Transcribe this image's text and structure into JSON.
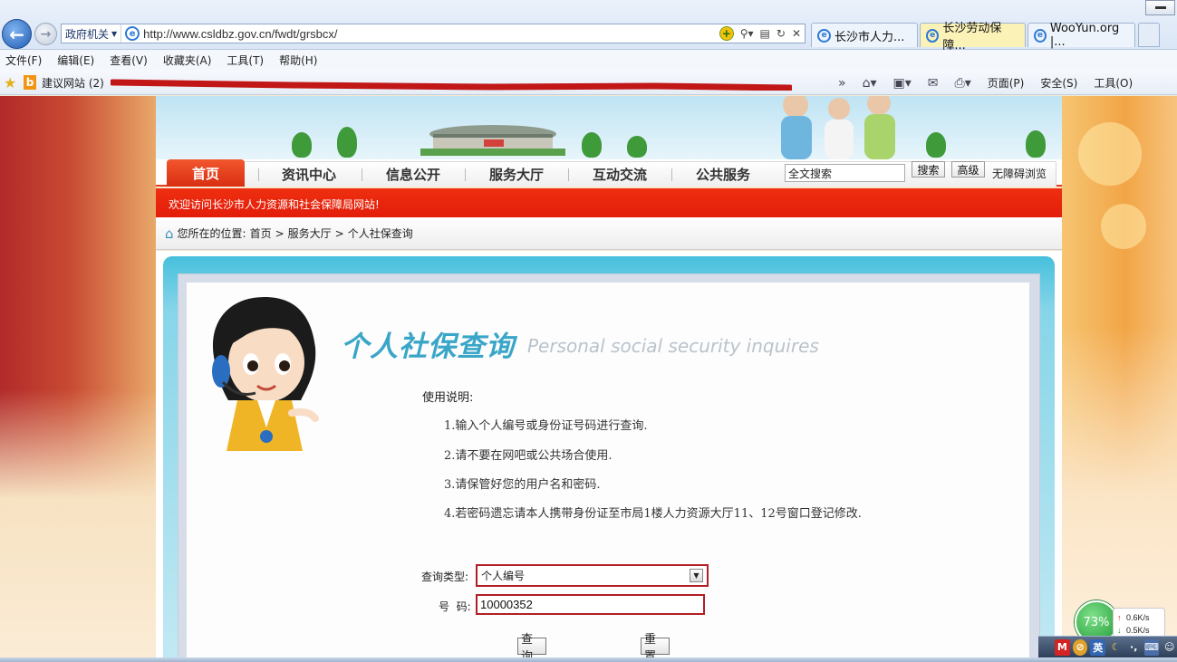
{
  "browser": {
    "site_tag": "政府机关",
    "url": "http://www.csldbz.gov.cn/fwdt/grsbcx/",
    "tabs": [
      {
        "label": "长沙市人力..."
      },
      {
        "label": "长沙劳动保障..."
      },
      {
        "label": "WooYun.org |..."
      }
    ],
    "menu": [
      "文件(F)",
      "编辑(E)",
      "查看(V)",
      "收藏夹(A)",
      "工具(T)",
      "帮助(H)"
    ],
    "favorites": {
      "suggested": "建议网站 (2)"
    },
    "toolbar_right": {
      "page": "页面(P)",
      "safety": "安全(S)",
      "tools": "工具(O)"
    }
  },
  "site": {
    "nav": [
      {
        "label": "首页"
      },
      {
        "label": "资讯中心"
      },
      {
        "label": "信息公开"
      },
      {
        "label": "服务大厅"
      },
      {
        "label": "互动交流"
      },
      {
        "label": "公共服务"
      }
    ],
    "search_value": "全文搜索",
    "search_button": "搜索",
    "advanced_button": "高级",
    "accessibility": "无障碍浏览",
    "welcome": "欢迎访问长沙市人力资源和社会保障局网站!",
    "breadcrumb": {
      "prefix": "您所在的位置:",
      "items": [
        "首页",
        "服务大厅",
        "个人社保查询"
      ],
      "sep": ">"
    }
  },
  "page": {
    "title_cn": "个人社保查询",
    "title_en": "Personal social security inquires",
    "instructions_head": "使用说明:",
    "instructions": [
      "1.输入个人编号或身份证号码进行查询.",
      "2.请不要在网吧或公共场合使用.",
      "3.请保管好您的用户名和密码.",
      "4.若密码遗忘请本人携带身份证至市局1楼人力资源大厅11、12号窗口登记修改."
    ],
    "form": {
      "type_label": "查询类型:",
      "type_value": "个人编号",
      "number_label": "号  码:",
      "number_value": "10000352",
      "submit": "查询",
      "reset": "重置"
    }
  },
  "overlay": {
    "speed_percent": "73%",
    "upload": "0.6K/s",
    "download": "0.5K/s",
    "ime": "英"
  },
  "colors": {
    "accent_red": "#e31d0a",
    "title_blue": "#3aa6c7",
    "highlight_border": "#b11f24"
  }
}
